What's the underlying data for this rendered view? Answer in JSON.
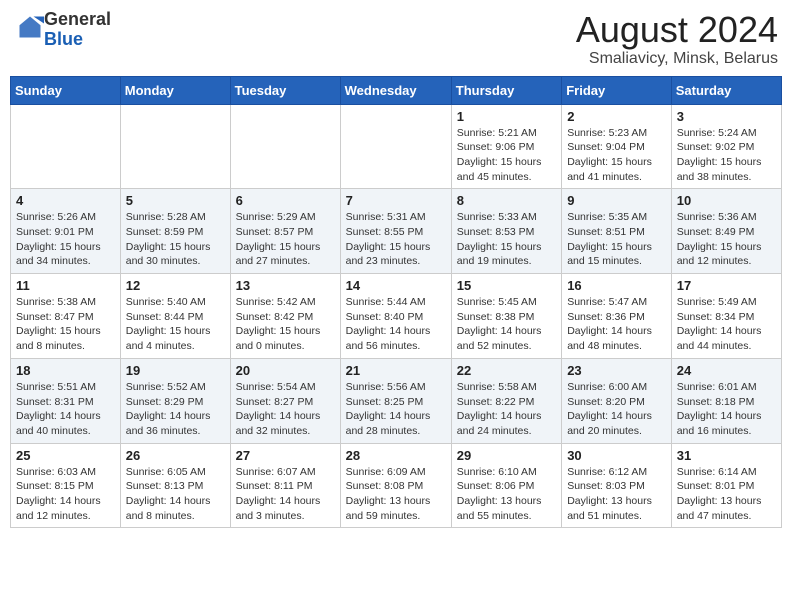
{
  "header": {
    "logo": {
      "text_general": "General",
      "text_blue": "Blue",
      "aria": "GeneralBlue Logo"
    },
    "month": "August 2024",
    "location": "Smaliavicy, Minsk, Belarus"
  },
  "weekdays": [
    "Sunday",
    "Monday",
    "Tuesday",
    "Wednesday",
    "Thursday",
    "Friday",
    "Saturday"
  ],
  "weeks": [
    [
      {
        "day": "",
        "info": ""
      },
      {
        "day": "",
        "info": ""
      },
      {
        "day": "",
        "info": ""
      },
      {
        "day": "",
        "info": ""
      },
      {
        "day": "1",
        "info": "Sunrise: 5:21 AM\nSunset: 9:06 PM\nDaylight: 15 hours\nand 45 minutes."
      },
      {
        "day": "2",
        "info": "Sunrise: 5:23 AM\nSunset: 9:04 PM\nDaylight: 15 hours\nand 41 minutes."
      },
      {
        "day": "3",
        "info": "Sunrise: 5:24 AM\nSunset: 9:02 PM\nDaylight: 15 hours\nand 38 minutes."
      }
    ],
    [
      {
        "day": "4",
        "info": "Sunrise: 5:26 AM\nSunset: 9:01 PM\nDaylight: 15 hours\nand 34 minutes."
      },
      {
        "day": "5",
        "info": "Sunrise: 5:28 AM\nSunset: 8:59 PM\nDaylight: 15 hours\nand 30 minutes."
      },
      {
        "day": "6",
        "info": "Sunrise: 5:29 AM\nSunset: 8:57 PM\nDaylight: 15 hours\nand 27 minutes."
      },
      {
        "day": "7",
        "info": "Sunrise: 5:31 AM\nSunset: 8:55 PM\nDaylight: 15 hours\nand 23 minutes."
      },
      {
        "day": "8",
        "info": "Sunrise: 5:33 AM\nSunset: 8:53 PM\nDaylight: 15 hours\nand 19 minutes."
      },
      {
        "day": "9",
        "info": "Sunrise: 5:35 AM\nSunset: 8:51 PM\nDaylight: 15 hours\nand 15 minutes."
      },
      {
        "day": "10",
        "info": "Sunrise: 5:36 AM\nSunset: 8:49 PM\nDaylight: 15 hours\nand 12 minutes."
      }
    ],
    [
      {
        "day": "11",
        "info": "Sunrise: 5:38 AM\nSunset: 8:47 PM\nDaylight: 15 hours\nand 8 minutes."
      },
      {
        "day": "12",
        "info": "Sunrise: 5:40 AM\nSunset: 8:44 PM\nDaylight: 15 hours\nand 4 minutes."
      },
      {
        "day": "13",
        "info": "Sunrise: 5:42 AM\nSunset: 8:42 PM\nDaylight: 15 hours\nand 0 minutes."
      },
      {
        "day": "14",
        "info": "Sunrise: 5:44 AM\nSunset: 8:40 PM\nDaylight: 14 hours\nand 56 minutes."
      },
      {
        "day": "15",
        "info": "Sunrise: 5:45 AM\nSunset: 8:38 PM\nDaylight: 14 hours\nand 52 minutes."
      },
      {
        "day": "16",
        "info": "Sunrise: 5:47 AM\nSunset: 8:36 PM\nDaylight: 14 hours\nand 48 minutes."
      },
      {
        "day": "17",
        "info": "Sunrise: 5:49 AM\nSunset: 8:34 PM\nDaylight: 14 hours\nand 44 minutes."
      }
    ],
    [
      {
        "day": "18",
        "info": "Sunrise: 5:51 AM\nSunset: 8:31 PM\nDaylight: 14 hours\nand 40 minutes."
      },
      {
        "day": "19",
        "info": "Sunrise: 5:52 AM\nSunset: 8:29 PM\nDaylight: 14 hours\nand 36 minutes."
      },
      {
        "day": "20",
        "info": "Sunrise: 5:54 AM\nSunset: 8:27 PM\nDaylight: 14 hours\nand 32 minutes."
      },
      {
        "day": "21",
        "info": "Sunrise: 5:56 AM\nSunset: 8:25 PM\nDaylight: 14 hours\nand 28 minutes."
      },
      {
        "day": "22",
        "info": "Sunrise: 5:58 AM\nSunset: 8:22 PM\nDaylight: 14 hours\nand 24 minutes."
      },
      {
        "day": "23",
        "info": "Sunrise: 6:00 AM\nSunset: 8:20 PM\nDaylight: 14 hours\nand 20 minutes."
      },
      {
        "day": "24",
        "info": "Sunrise: 6:01 AM\nSunset: 8:18 PM\nDaylight: 14 hours\nand 16 minutes."
      }
    ],
    [
      {
        "day": "25",
        "info": "Sunrise: 6:03 AM\nSunset: 8:15 PM\nDaylight: 14 hours\nand 12 minutes."
      },
      {
        "day": "26",
        "info": "Sunrise: 6:05 AM\nSunset: 8:13 PM\nDaylight: 14 hours\nand 8 minutes."
      },
      {
        "day": "27",
        "info": "Sunrise: 6:07 AM\nSunset: 8:11 PM\nDaylight: 14 hours\nand 3 minutes."
      },
      {
        "day": "28",
        "info": "Sunrise: 6:09 AM\nSunset: 8:08 PM\nDaylight: 13 hours\nand 59 minutes."
      },
      {
        "day": "29",
        "info": "Sunrise: 6:10 AM\nSunset: 8:06 PM\nDaylight: 13 hours\nand 55 minutes."
      },
      {
        "day": "30",
        "info": "Sunrise: 6:12 AM\nSunset: 8:03 PM\nDaylight: 13 hours\nand 51 minutes."
      },
      {
        "day": "31",
        "info": "Sunrise: 6:14 AM\nSunset: 8:01 PM\nDaylight: 13 hours\nand 47 minutes."
      }
    ]
  ]
}
